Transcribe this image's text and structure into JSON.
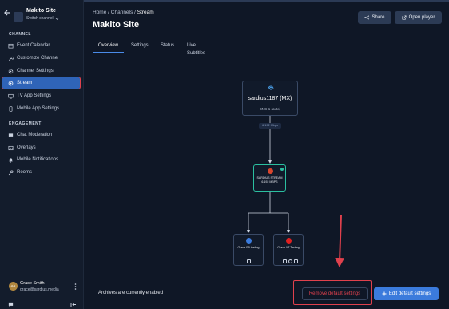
{
  "sidebar": {
    "site_name": "Makito Site",
    "switch_label": "Switch channel",
    "section_channel": "CHANNEL",
    "section_engagement": "ENGAGEMENT",
    "items": [
      {
        "label": "Event Calendar",
        "icon": "calendar-icon"
      },
      {
        "label": "Customize Channel",
        "icon": "wrench-icon"
      },
      {
        "label": "Channel Settings",
        "icon": "gear-icon"
      },
      {
        "label": "Stream",
        "icon": "stream-icon",
        "active": true
      },
      {
        "label": "TV App Settings",
        "icon": "tv-icon"
      },
      {
        "label": "Mobile App Settings",
        "icon": "phone-icon"
      },
      {
        "label": "Chat Moderation",
        "icon": "chat-icon"
      },
      {
        "label": "Overlays",
        "icon": "image-icon"
      },
      {
        "label": "Mobile Notifications",
        "icon": "bell-icon"
      },
      {
        "label": "Rooms",
        "icon": "key-icon"
      }
    ],
    "user": {
      "initials": "GS",
      "name": "Grace Smith",
      "email": "grace@sardius.media"
    }
  },
  "header": {
    "breadcrumb": [
      "Home",
      "Channels",
      "Stream"
    ],
    "title": "Makito Site",
    "share_label": "Share",
    "open_player_label": "Open player"
  },
  "tabs": [
    "Overview",
    "Settings",
    "Status",
    "Live Subtitles"
  ],
  "diagram": {
    "source_title": "sardius1187 (MX)",
    "source_sub": "BNC-1 (auto)",
    "bitrate": "6.192 Mbps",
    "stream_title": "SARDIUS STREAM",
    "stream_sub": "6.192 MBPS",
    "destinations": [
      {
        "title": "Grace FB testing",
        "icon": "facebook-icon",
        "color": "#3b7bdc"
      },
      {
        "title": "Grace YT Testing",
        "icon": "youtube-icon",
        "color": "#e02020"
      }
    ]
  },
  "footer": {
    "archives_text": "Archives are currently enabled",
    "remove_label": "Remove default settings",
    "edit_label": "Edit default settings"
  },
  "colors": {
    "background": "#0f1726",
    "accent": "#3b7bdc",
    "highlight": "#e0414d",
    "stream_border": "#2bbfa0"
  }
}
